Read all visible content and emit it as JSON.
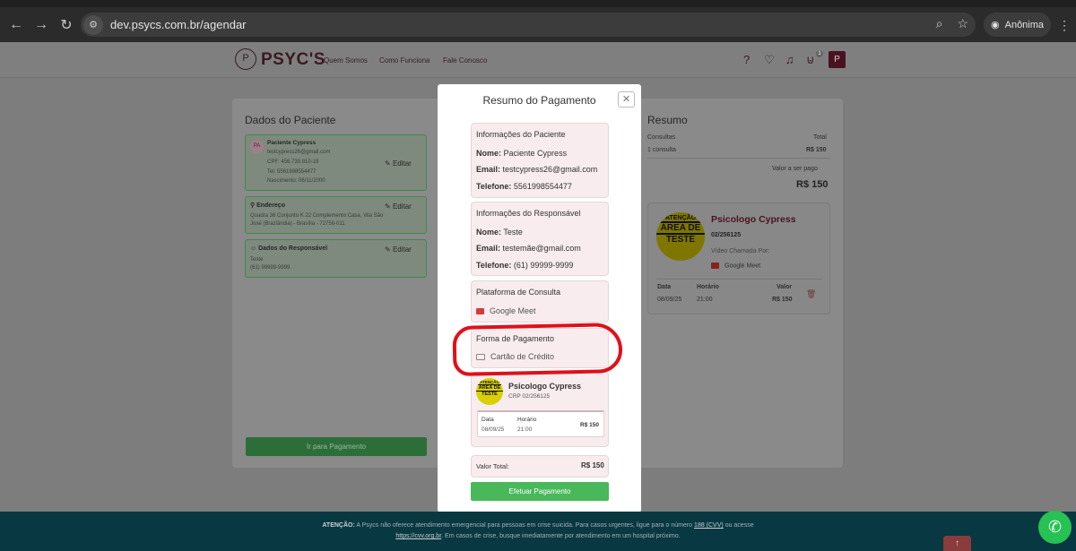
{
  "browser": {
    "url": "dev.psycs.com.br/agendar",
    "profile_label": "Anônima"
  },
  "header": {
    "logo_mark": "P",
    "logo_text": "PSYC'S",
    "nav": [
      "Quem Somos",
      "Como Funciona",
      "Fale Conosco"
    ],
    "cart_count": "1",
    "user_initial": "P"
  },
  "patient_panel": {
    "title": "Dados do Paciente",
    "patient": {
      "avatar_initials": "PA",
      "name": "Paciente Cypress",
      "email": "testcypress26@gmail.com",
      "cpf": "CPF: 456.739.810-19",
      "tel": "Tel: 5561998554477",
      "birth": "Nascimento: 06/11/2000"
    },
    "address": {
      "label": "Endereço",
      "line1": "Quadra 36 Conjunto K 22 Complemento Casa, Vila São",
      "line2": "José (Brazlândia) - Brasília - 72756-011"
    },
    "responsible": {
      "label": "Dados do Responsável",
      "name": "Teste",
      "phone": "(61) 99999-9999"
    },
    "edit_label": "Editar",
    "go_payment": "Ir para Pagamento"
  },
  "summary_panel": {
    "title": "Resumo",
    "consultas_label": "Consultas",
    "total_label": "Total",
    "count": "1 consulta",
    "total": "R$ 150",
    "to_pay_label": "Valor a ser pago",
    "to_pay": "R$ 150",
    "psychologist": {
      "badge_line1": "ATENÇÃO",
      "badge_line2": "ÁREA DE",
      "badge_line3": "TESTE",
      "name": "Psicologo Cypress",
      "crp": "02/256125",
      "platform_label": "Vídeo Chamada Por:",
      "platform": "Google Meet"
    },
    "date_label": "Data",
    "time_label": "Horário",
    "value_label": "Valor",
    "date": "08/09/25",
    "time": "21:00",
    "value": "R$ 150"
  },
  "modal": {
    "title": "Resumo do Pagamento",
    "patient_info": {
      "heading": "Informações do Paciente",
      "name_label": "Nome:",
      "name": "Paciente Cypress",
      "email_label": "Email:",
      "email": "testcypress26@gmail.com",
      "phone_label": "Telefone:",
      "phone": "5561998554477"
    },
    "responsible_info": {
      "heading": "Informações do Responsável",
      "name_label": "Nome:",
      "name": "Teste",
      "email_label": "Email:",
      "email": "testemãe@gmail.com",
      "phone_label": "Telefone:",
      "phone": "(61) 99999-9999"
    },
    "platform": {
      "heading": "Plataforma de Consulta",
      "value": "Google Meet"
    },
    "payment_method": {
      "heading": "Forma de Pagamento",
      "value": "Cartão de Crédito"
    },
    "psychologist": {
      "badge_line1": "ATENÇÃO",
      "badge_line2": "ÁREA DE",
      "badge_line3": "TESTE",
      "name": "Psicologo Cypress",
      "crp": "CRP 02/256125",
      "date_label": "Data",
      "time_label": "Horário",
      "date": "08/09/25",
      "time": "21:00",
      "value": "R$ 150"
    },
    "total_label": "Valor Total:",
    "total": "R$ 150",
    "confirm_button": "Efetuar Pagamento"
  },
  "footer": {
    "attention": "ATENÇÃO:",
    "text1": "A Psycs não oferece atendimento emergencial para pessoas em crise suicida. Para casos urgentes, ligue para o número",
    "cvv": "188 (CVV)",
    "text2": "ou acesse",
    "cvv_url": "https://cvv.org.br",
    "text3": ". Em casos de crise, busque imediatamente por atendimento em um hospital próximo."
  },
  "colors": {
    "brand": "#4a1220",
    "confirm": "#49b85a",
    "highlight_circle": "#e0101a",
    "footer_bg": "#083842"
  }
}
